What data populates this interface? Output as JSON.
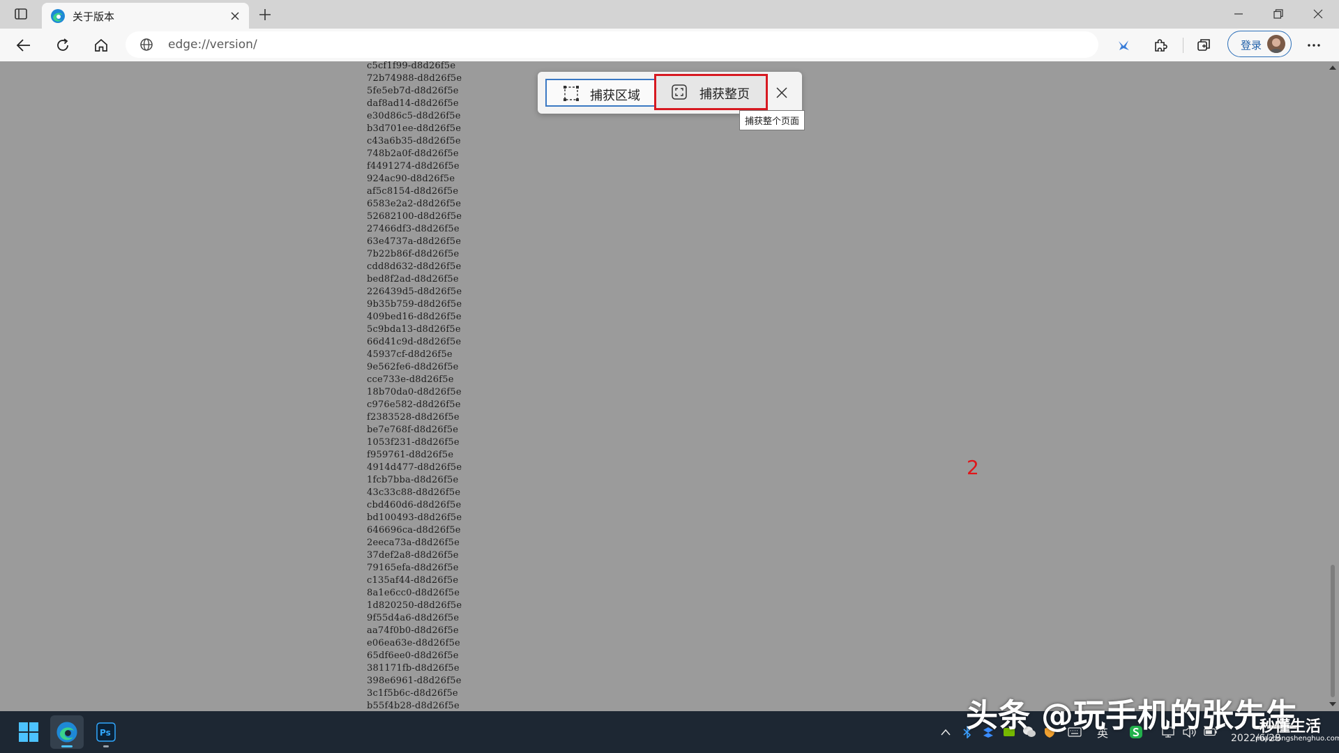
{
  "browser": {
    "tab": {
      "title": "关于版本"
    },
    "address": {
      "url": "edge://version/"
    },
    "profile": {
      "label": "登录"
    }
  },
  "capture": {
    "region_label": "捕获区域",
    "full_label": "捕获整页",
    "tooltip": "捕获整个页面"
  },
  "content": {
    "marker": "2",
    "hash_lines": [
      "c5cf1f99-d8d26f5e",
      "72b74988-d8d26f5e",
      "5fe5eb7d-d8d26f5e",
      "daf8ad14-d8d26f5e",
      "e30d86c5-d8d26f5e",
      "b3d701ee-d8d26f5e",
      "c43a6b35-d8d26f5e",
      "748b2a0f-d8d26f5e",
      "f4491274-d8d26f5e",
      "924ac90-d8d26f5e",
      "af5c8154-d8d26f5e",
      "6583e2a2-d8d26f5e",
      "52682100-d8d26f5e",
      "27466df3-d8d26f5e",
      "63e4737a-d8d26f5e",
      "7b22b86f-d8d26f5e",
      "cdd8d632-d8d26f5e",
      "bed8f2ad-d8d26f5e",
      "226439d5-d8d26f5e",
      "9b35b759-d8d26f5e",
      "409bed16-d8d26f5e",
      "5c9bda13-d8d26f5e",
      "66d41c9d-d8d26f5e",
      "45937cf-d8d26f5e",
      "9e562fe6-d8d26f5e",
      "cce733e-d8d26f5e",
      "18b70da0-d8d26f5e",
      "c976e582-d8d26f5e",
      "f2383528-d8d26f5e",
      "be7e768f-d8d26f5e",
      "1053f231-d8d26f5e",
      "f959761-d8d26f5e",
      "4914d477-d8d26f5e",
      "1fcb7bba-d8d26f5e",
      "43c33c88-d8d26f5e",
      "cbd460d6-d8d26f5e",
      "bd100493-d8d26f5e",
      "646696ca-d8d26f5e",
      "2eeca73a-d8d26f5e",
      "37def2a8-d8d26f5e",
      "79165efa-d8d26f5e",
      "c135af44-d8d26f5e",
      "8a1e6cc0-d8d26f5e",
      "1d820250-d8d26f5e",
      "9f55d4a6-d8d26f5e",
      "aa74f0b0-d8d26f5e",
      "e06ea63e-d8d26f5e",
      "65df6ee0-d8d26f5e",
      "381171fb-d8d26f5e",
      "398e6961-d8d26f5e",
      "3c1f5b6c-d8d26f5e",
      "b55f4b28-d8d26f5e"
    ]
  },
  "taskbar": {
    "ime_label": "英",
    "date": "2022/6/28"
  },
  "watermark": {
    "main": "头条 @玩手机的张先生",
    "brand": "秒懂生活",
    "url": "miaodongshenghuo.com"
  },
  "icons": {
    "tab_actions": "tab-actions-icon",
    "favicon": "edge-logo-icon",
    "close": "close-icon",
    "new_tab": "plus-icon",
    "back": "back-arrow-icon",
    "refresh": "refresh-icon",
    "home": "home-icon",
    "site_info": "globe-icon",
    "favorites": "star-pin-icon",
    "extensions": "puzzle-icon",
    "collections": "collections-icon",
    "menu": "more-icon"
  },
  "colors": {
    "accent": "#3a78c3",
    "highlight": "#d71921",
    "marker": "#e0161a"
  }
}
